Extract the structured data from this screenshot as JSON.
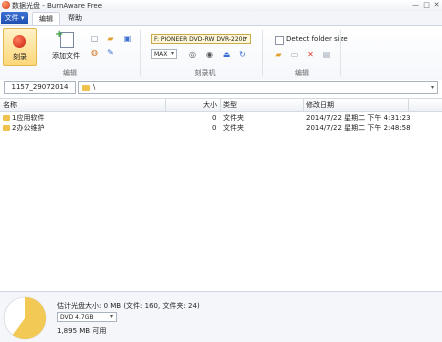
{
  "window": {
    "title": "数据光盘 - BurnAware Free",
    "min_glyph": "—",
    "max_glyph": "□",
    "close_glyph": "✕"
  },
  "tabs": {
    "file": "文件 ▾",
    "edit": "编辑",
    "help": "帮助"
  },
  "ribbon": {
    "burn_label": "刻录",
    "add_files_label": "添加文件",
    "group_edit": "编辑",
    "group_recorder": "刻录机",
    "group_edit2": "编辑",
    "drive_value": "F: PIONEER DVD-RW  DVR-220L",
    "speed_value": "MAX",
    "detect_folder_size_label": "Detect folder size",
    "dropdown_glyph": "▾"
  },
  "pathbar": {
    "disc_label": "1157_29072014",
    "path": "\\",
    "dropdown_glyph": "▾"
  },
  "columns": {
    "name": "名称",
    "size": "大小",
    "type": "类型",
    "modified": "修改日期"
  },
  "rows": [
    {
      "name": "1应用软件",
      "size": "0",
      "type": "文件夹",
      "modified": "2014/7/22 星期二 下午 4:31:23"
    },
    {
      "name": "2办公维护",
      "size": "0",
      "type": "文件夹",
      "modified": "2014/7/22 星期二 下午 2:48:58"
    }
  ],
  "status": {
    "estimate_text": "估计光盘大小: 0 MB (文件: 160, 文件夹: 24)",
    "disc_type": "DVD 4.7GB",
    "free_text": "1,895 MB 可用",
    "used_fraction": 0.6,
    "used_color": "#f2c955",
    "free_color": "#ffffff"
  }
}
